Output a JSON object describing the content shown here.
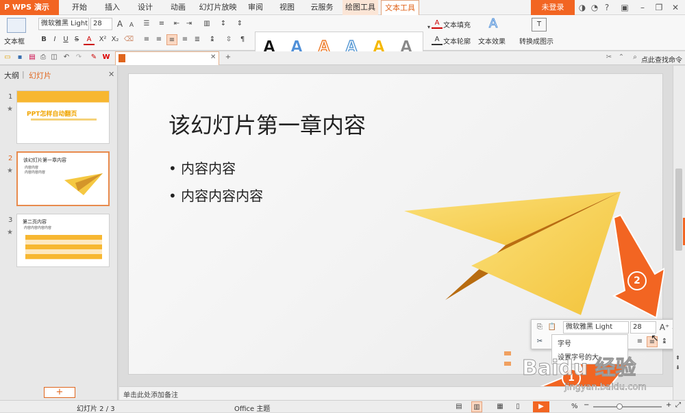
{
  "app": {
    "name": "WPS 演示"
  },
  "tabs": [
    "开始",
    "插入",
    "设计",
    "动画",
    "幻灯片放映",
    "审阅",
    "视图",
    "云服务",
    "绘图工具",
    "文本工具"
  ],
  "title_bar": {
    "login_label": "未登录"
  },
  "ribbon": {
    "textbox_label": "文本框",
    "font_name": "微软雅黑 Light",
    "font_size": "28",
    "text_fill_label": "文本填充",
    "text_outline_label": "文本轮廓",
    "text_effect_label": "文本效果",
    "convert_label": "转换成图示",
    "wordart_letter": "A",
    "font_grow": "A",
    "font_shrink": "A"
  },
  "quick_access": {
    "search_placeholder": "点此查找命令"
  },
  "left_panel": {
    "tab_outline": "大纲",
    "tab_slides": "幻灯片",
    "thumbs": [
      {
        "num": "1",
        "title": "PPT怎样自动翻页"
      },
      {
        "num": "2",
        "title": "该幻灯片第一章内容",
        "bullets": [
          "内容内容",
          "内容内容内容"
        ]
      },
      {
        "num": "3",
        "title": "第二页内容",
        "sub": "内容内容内容内容"
      }
    ],
    "add_label": "+"
  },
  "slide": {
    "title": "该幻灯片第一章内容",
    "bullets": [
      "内容内容",
      "内容内容内容"
    ]
  },
  "notes": {
    "placeholder": "单击此处添加备注"
  },
  "status": {
    "slide_counter": "幻灯片 2 / 3",
    "theme": "Office 主题",
    "zoom_suffix": "%"
  },
  "float_toolbar": {
    "font_name": "微软雅黑 Light",
    "font_size": "28",
    "tooltip_title": "字号",
    "tooltip_desc": "设置字号的大"
  },
  "annotations": {
    "badge1": "1",
    "badge2": "2"
  },
  "watermark": {
    "text": "Baidu 经验",
    "url": "jingyan.baidu.com"
  },
  "colors": {
    "accent": "#f26522",
    "slide_plane": "#f5c842"
  }
}
